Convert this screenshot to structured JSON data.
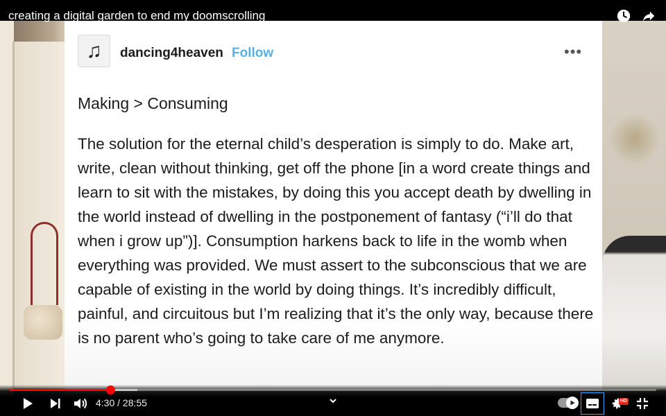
{
  "video": {
    "title": "creating a digital garden to end my doomscrolling"
  },
  "post": {
    "avatar_glyph": "♫",
    "username": "dancing4heaven",
    "follow_label": "Follow",
    "more_label": "•••",
    "heading": "Making > Consuming",
    "body": "The solution for the eternal child’s desperation is simply to do. Make art, write, clean without thinking, get off the phone [in a word create things and learn to sit with the mistakes, by doing this you accept death by dwelling in the world instead of dwelling in the postponement of fantasy (“i’ll do that when i grow up”)]. Consumption harkens back to life in the womb when everything was provided. We must assert to the subconscious that we are capable of existing in the world by doing things. It’s incredibly difficult, painful, and circuitous but I’m realizing that it’s the only way, because there is no parent who’s going to take care of me anymore."
  },
  "player": {
    "current_time": "4:30",
    "duration": "28:55",
    "time_display": "4:30 / 28:55",
    "played_fraction": 0.156,
    "buffered_fraction": 0.197,
    "hd_badge": "HD",
    "accent_color": "#ff0000",
    "follow_color": "#5ab1e1"
  }
}
